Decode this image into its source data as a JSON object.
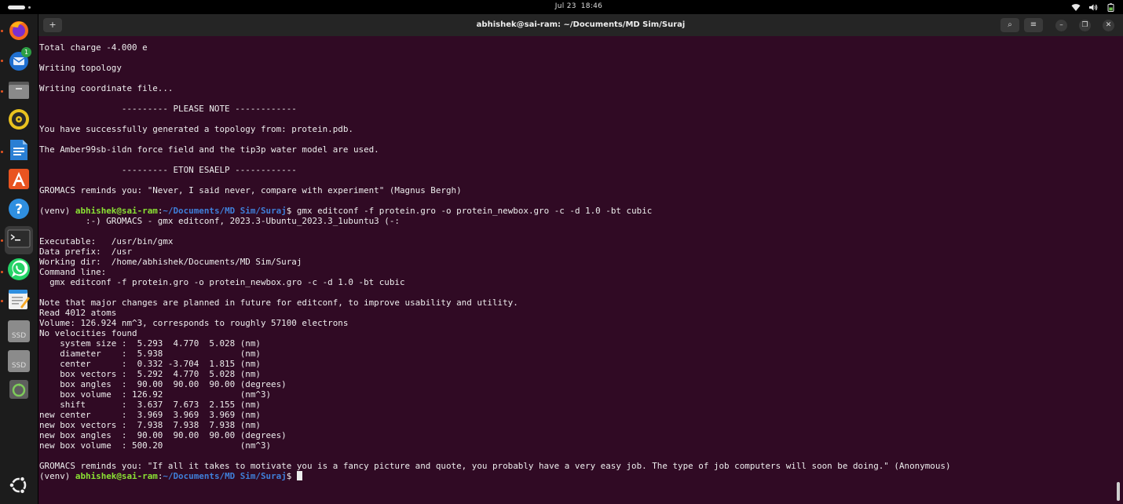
{
  "topbar": {
    "date": "Jul 23",
    "time": "18:46"
  },
  "dock": {
    "items": [
      {
        "name": "firefox",
        "icon": "firefox-icon"
      },
      {
        "name": "thunderbird",
        "icon": "mail-icon",
        "badge": "1"
      },
      {
        "name": "files",
        "icon": "files-icon"
      },
      {
        "name": "rhythmbox",
        "icon": "music-icon"
      },
      {
        "name": "writer",
        "icon": "writer-icon"
      },
      {
        "name": "app-center",
        "icon": "app-center-icon"
      },
      {
        "name": "help",
        "icon": "help-icon"
      },
      {
        "name": "terminal",
        "icon": "terminal-icon"
      },
      {
        "name": "whatsapp",
        "icon": "whatsapp-icon"
      },
      {
        "name": "text-editor",
        "icon": "text-editor-icon"
      },
      {
        "name": "ssd-1",
        "icon": "drive-icon",
        "label": "SSD"
      },
      {
        "name": "ssd-2",
        "icon": "drive-icon",
        "label": "SSD"
      },
      {
        "name": "trash",
        "icon": "trash-icon"
      },
      {
        "name": "show-apps",
        "icon": "ubuntu-icon"
      }
    ]
  },
  "window": {
    "title": "abhishek@sai-ram: ~/Documents/MD Sim/Suraj",
    "new_tab_icon": "+",
    "search_icon": "⌕",
    "menu_icon": "≡",
    "minimize_icon": "–",
    "restore_icon": "❐",
    "close_icon": "✕"
  },
  "terminal": {
    "prompt": {
      "venv": "(venv) ",
      "user": "abhishek@sai-ram",
      "sep": ":",
      "path": "~/Documents/MD Sim/Suraj",
      "dollar": "$ "
    },
    "lines": [
      "Total charge -4.000 e",
      "",
      "Writing topology",
      "",
      "Writing coordinate file...",
      "",
      "                --------- PLEASE NOTE ------------",
      "",
      "You have successfully generated a topology from: protein.pdb.",
      "",
      "The Amber99sb-ildn force field and the tip3p water model are used.",
      "",
      "                --------- ETON ESAELP ------------",
      "",
      "GROMACS reminds you: \"Never, I said never, compare with experiment\" (Magnus Bergh)",
      "",
      "",
      "         :-) GROMACS - gmx editconf, 2023.3-Ubuntu_2023.3_1ubuntu3 (-:",
      "",
      "Executable:   /usr/bin/gmx",
      "Data prefix:  /usr",
      "Working dir:  /home/abhishek/Documents/MD Sim/Suraj",
      "Command line:",
      "  gmx editconf -f protein.gro -o protein_newbox.gro -c -d 1.0 -bt cubic",
      "",
      "Note that major changes are planned in future for editconf, to improve usability and utility.",
      "Read 4012 atoms",
      "Volume: 126.924 nm^3, corresponds to roughly 57100 electrons",
      "No velocities found",
      "    system size :  5.293  4.770  5.028 (nm)",
      "    diameter    :  5.938               (nm)",
      "    center      :  0.332 -3.704  1.815 (nm)",
      "    box vectors :  5.292  4.770  5.028 (nm)",
      "    box angles  :  90.00  90.00  90.00 (degrees)",
      "    box volume  : 126.92               (nm^3)",
      "    shift       :  3.637  7.673  2.155 (nm)",
      "new center      :  3.969  3.969  3.969 (nm)",
      "new box vectors :  7.938  7.938  7.938 (nm)",
      "new box angles  :  90.00  90.00  90.00 (degrees)",
      "new box volume  : 500.20               (nm^3)",
      "",
      "GROMACS reminds you: \"If all it takes to motivate you is a fancy picture and quote, you probably have a very easy job. The type of job computers will soon be doing.\" (Anonymous)",
      ""
    ],
    "command_1": "gmx editconf -f protein.gro -o protein_newbox.gro -c -d 1.0 -bt cubic",
    "command_1_line_index": 16,
    "final_prompt_line_index": 42
  }
}
